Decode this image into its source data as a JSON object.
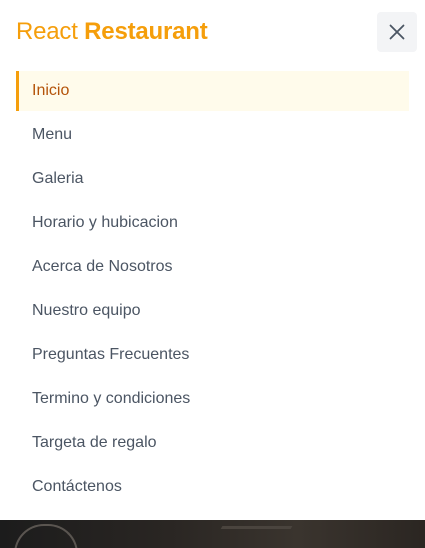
{
  "header": {
    "brand_light": "React",
    "brand_bold": "Restaurant",
    "close_icon": "close-icon"
  },
  "colors": {
    "accent": "#f59e0b",
    "active_bg": "#fffbeb",
    "active_text": "#b45309",
    "text": "#4b5563"
  },
  "nav": {
    "active_index": 0,
    "items": [
      {
        "label": "Inicio"
      },
      {
        "label": "Menu"
      },
      {
        "label": "Galeria"
      },
      {
        "label": "Horario y hubicacion"
      },
      {
        "label": "Acerca de Nosotros"
      },
      {
        "label": "Nuestro equipo"
      },
      {
        "label": "Preguntas Frecuentes"
      },
      {
        "label": "Termino y condiciones"
      },
      {
        "label": "Targeta de regalo"
      },
      {
        "label": "Contáctenos"
      }
    ]
  }
}
